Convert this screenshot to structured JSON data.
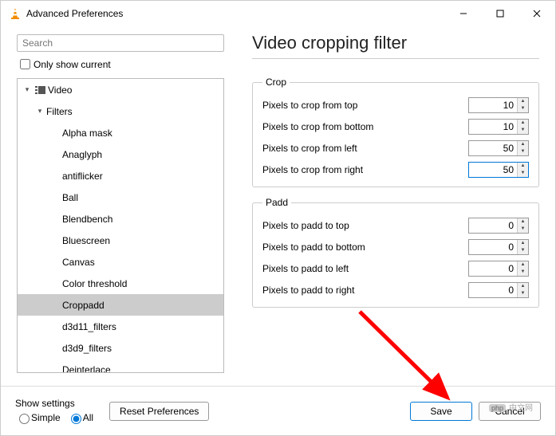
{
  "window": {
    "title": "Advanced Preferences"
  },
  "sidebar": {
    "search_placeholder": "Search",
    "only_show_current": "Only show current",
    "tree": {
      "video": "Video",
      "filters": "Filters",
      "items": [
        "Alpha mask",
        "Anaglyph",
        "antiflicker",
        "Ball",
        "Blendbench",
        "Bluescreen",
        "Canvas",
        "Color threshold",
        "Croppadd",
        "d3d11_filters",
        "d3d9_filters",
        "Deinterlace"
      ],
      "selected_index": 8
    }
  },
  "main": {
    "title": "Video cropping filter",
    "crop": {
      "legend": "Crop",
      "rows": [
        {
          "label": "Pixels to crop from top",
          "value": "10"
        },
        {
          "label": "Pixels to crop from bottom",
          "value": "10"
        },
        {
          "label": "Pixels to crop from left",
          "value": "50"
        },
        {
          "label": "Pixels to crop from right",
          "value": "50"
        }
      ],
      "active_row": 3
    },
    "padd": {
      "legend": "Padd",
      "rows": [
        {
          "label": "Pixels to padd to top",
          "value": "0"
        },
        {
          "label": "Pixels to padd to bottom",
          "value": "0"
        },
        {
          "label": "Pixels to padd to left",
          "value": "0"
        },
        {
          "label": "Pixels to padd to right",
          "value": "0"
        }
      ]
    }
  },
  "footer": {
    "show_settings": "Show settings",
    "simple": "Simple",
    "all": "All",
    "reset": "Reset Preferences",
    "save": "Save",
    "cancel": "Cancel"
  },
  "watermark": {
    "tag": "php",
    "text": "中文网"
  }
}
